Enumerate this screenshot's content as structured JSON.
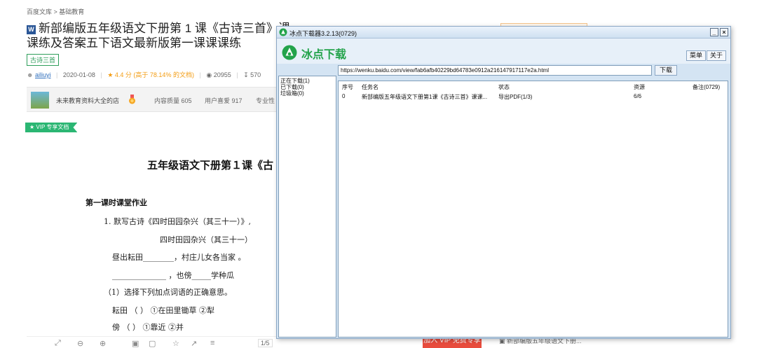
{
  "page": {
    "breadcrumb": "百度文库 > 基础教育",
    "word_icon": "W",
    "title": "新部编版五年级语文下册第 1 课《古诗三首》课课练及答案五下语文最新版第一课课课练",
    "tag": "古诗三首",
    "meta": {
      "author": "ailiuyi",
      "date": "2020-01-08",
      "rating": "4.4 分 (高于 78.14% 的文档)",
      "views": "20955",
      "downloads": "570"
    },
    "store": {
      "name": "未来教育资料大全的店",
      "quality": "内容质量 605",
      "likes": "用户喜爱 917",
      "pro": "专业性"
    },
    "vip_ribbon": "VIP 专享文档",
    "doc": {
      "heading": "五年级语文下册第１课《古",
      "section": "第一课时课堂作业",
      "lines": [
        "1. 默写古诗《四时田园杂兴（其三十一）》,",
        "四时田园杂兴（其三十一）",
        "昼出耘田________，村庄儿女各当家 。",
        "______________ ，也傍_____学种瓜",
        "（1）选择下列加点词语的正确意思。",
        "耘田   （      ） ①在田里锄草    ②犁",
        "傍     （      ） ①靠近          ②并"
      ]
    },
    "page_num": "1/5",
    "vip_button": "加入 VIP 免费专享",
    "related": "新部编版五年级语文下册..."
  },
  "downloader": {
    "title": "冰点下载器3.2.13(0729)",
    "app_name": "冰点下载",
    "menu_label": "菜单",
    "about_label": "关于",
    "url": "https://wenku.baidu.com/view/fab6afb40229bd64783e0912a216147917117e2a.html",
    "download_label": "下载",
    "sidebar": [
      "正在下载(1)",
      "已下载(0)",
      "垃圾箱(0)"
    ],
    "columns": {
      "index": "序号",
      "name": "任务名",
      "status": "状态",
      "resource": "资源",
      "note": "备注(0729)"
    },
    "rows": [
      {
        "index": "0",
        "name": "新部编版五年级语文下册第1课《古诗三首》课课...",
        "status": "导出PDF(1/3)",
        "resource": "6/6",
        "note": ""
      }
    ]
  },
  "colors": {
    "brand_green": "#23a34b",
    "vip_green": "#2bb673",
    "rating_orange": "#f39c12",
    "vip_red": "#e84c3d",
    "window_blue": "#d4e4f3"
  },
  "icons": {
    "logo": "bingdian-logo-icon",
    "minimize": "minimize-icon",
    "close": "close-icon",
    "user": "user-icon",
    "star": "star-icon",
    "eye": "eye-icon",
    "download": "download-icon"
  }
}
